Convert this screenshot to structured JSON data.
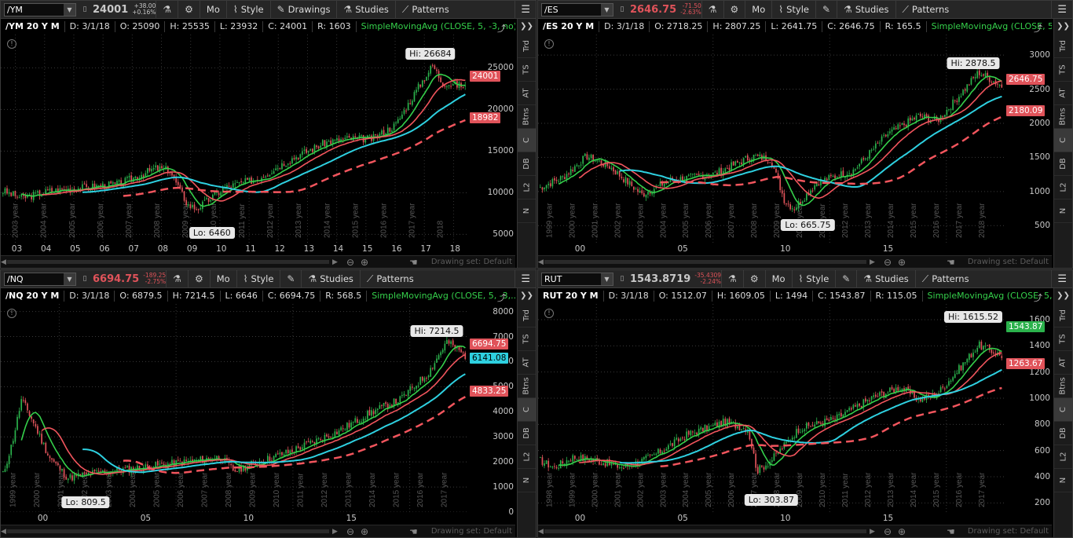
{
  "panels": [
    {
      "symbol": "/YM",
      "price": "24001",
      "price_color": "#c8c8c8",
      "chg1": "+38.00",
      "chg2": "+0.16%",
      "chg_color": "#c8c8c8",
      "buttons": [
        "Mo",
        "Style",
        "Drawings",
        "Studies",
        "Patterns"
      ],
      "info": [
        "/YM 20 Y M",
        "D: 3/1/18",
        "O: 25090",
        "H: 25535",
        "L: 23932",
        "C: 24001",
        "R: 1603",
        "SimpleMovingAvg (CLOSE, 5, -3, no)"
      ],
      "y_ticks": [
        "25000",
        "20000",
        "15000",
        "10000",
        "5000"
      ],
      "hi": "Hi: 26684",
      "lo": "Lo: 6460",
      "tags": [
        {
          "text": "24001",
          "color": "#e0535a"
        },
        {
          "text": "18982",
          "color": "#e0535a"
        }
      ],
      "x_ticks": [
        "03",
        "04",
        "05",
        "06",
        "07",
        "08",
        "09",
        "10",
        "11",
        "12",
        "13",
        "14",
        "15",
        "16",
        "17",
        "18"
      ],
      "year_labels": [
        "2003 year",
        "2004 year",
        "2005 year",
        "2006 year",
        "2007 year",
        "2008 year",
        "2009 year",
        "2010 year",
        "2011 year",
        "2012 year",
        "2013 year",
        "2014 year",
        "2015 year",
        "2016 year",
        "2017 year",
        "2018"
      ],
      "drawing_set": "Drawing set: Default"
    },
    {
      "symbol": "/ES",
      "price": "2646.75",
      "price_color": "#e0535a",
      "chg1": "-71.50",
      "chg2": "-2.63%",
      "chg_color": "#e0535a",
      "buttons": [
        "Mo",
        "Style",
        "",
        "Studies",
        "Patterns"
      ],
      "info": [
        "/ES 20 Y M",
        "D: 3/1/18",
        "O: 2718.25",
        "H: 2807.25",
        "L: 2641.75",
        "C: 2646.75",
        "R: 165.5",
        "SimpleMovingAvg (CLOSE, 5,..."
      ],
      "y_ticks": [
        "3000",
        "2500",
        "2000",
        "1500",
        "1000",
        "500"
      ],
      "hi": "Hi: 2878.5",
      "lo": "Lo: 665.75",
      "tags": [
        {
          "text": "2646.75",
          "color": "#e0535a"
        },
        {
          "text": "2180.09",
          "color": "#e0535a"
        }
      ],
      "x_ticks": [
        "00",
        "05",
        "10",
        "15"
      ],
      "year_labels": [
        "1999 year",
        "2000 year",
        "2001 year",
        "2002 year",
        "2003 year",
        "2004 year",
        "2005 year",
        "2006 year",
        "2007 year",
        "2008 year",
        "2009 year",
        "2010 year",
        "2011 year",
        "2012 year",
        "2013 year",
        "2014 year",
        "2015 year",
        "2016 year",
        "2017 year",
        "2018 year"
      ],
      "drawing_set": "Drawing set: Default"
    },
    {
      "symbol": "/NQ",
      "price": "6694.75",
      "price_color": "#e0535a",
      "chg1": "-189.25",
      "chg2": "-2.75%",
      "chg_color": "#e0535a",
      "buttons": [
        "Mo",
        "Style",
        "",
        "Studies",
        "Patterns"
      ],
      "info": [
        "/NQ 20 Y M",
        "D: 3/1/18",
        "O: 6879.5",
        "H: 7214.5",
        "L: 6646",
        "C: 6694.75",
        "R: 568.5",
        "SimpleMovingAvg (CLOSE, 5, -3,..."
      ],
      "y_ticks": [
        "8000",
        "7000",
        "6000",
        "5000",
        "4000",
        "3000",
        "2000",
        "1000",
        "0"
      ],
      "hi": "Hi: 7214.5",
      "lo": "Lo: 809.5",
      "tags": [
        {
          "text": "6694.75",
          "color": "#e0535a"
        },
        {
          "text": "6141.08",
          "color": "#2ed0e0"
        },
        {
          "text": "4833.25",
          "color": "#e0535a"
        }
      ],
      "x_ticks": [
        "00",
        "05",
        "10",
        "15"
      ],
      "year_labels": [
        "1999 year",
        "2000 year",
        "2001 year",
        "2002 year",
        "2003 year",
        "2004 year",
        "2005 year",
        "2006 year",
        "2007 year",
        "2008 year",
        "2009 year",
        "2010 year",
        "2011 year",
        "2012 year",
        "2013 year",
        "2014 year",
        "2015 year",
        "2016 year",
        "2017 year"
      ],
      "drawing_set": "Drawing set: Default"
    },
    {
      "symbol": "RUT",
      "price": "1543.8719",
      "price_color": "#c8c8c8",
      "chg1": "-35.4309",
      "chg2": "-2.24%",
      "chg_color": "#e0535a",
      "buttons": [
        "Mo",
        "Style",
        "",
        "Studies",
        "Patterns"
      ],
      "info": [
        "RUT 20 Y M",
        "D: 3/1/18",
        "O: 1512.07",
        "H: 1609.05",
        "L: 1494",
        "C: 1543.87",
        "R: 115.05",
        "SimpleMovingAvg (CLOSE, 5, -3,..."
      ],
      "y_ticks": [
        "1600",
        "1400",
        "1200",
        "1000",
        "800",
        "600",
        "400",
        "200"
      ],
      "hi": "Hi: 1615.52",
      "lo": "Lo: 303.87",
      "tags": [
        {
          "text": "1543.87",
          "color": "#2bb24c"
        },
        {
          "text": "1263.67",
          "color": "#e0535a"
        }
      ],
      "x_ticks": [
        "00",
        "05",
        "10",
        "15"
      ],
      "year_labels": [
        "1998 year",
        "1999 year",
        "2000 year",
        "2001 year",
        "2002 year",
        "2003 year",
        "2004 year",
        "2005 year",
        "2006 year",
        "2007 year",
        "2008 year",
        "2009 year",
        "2010 year",
        "2011 year",
        "2012 year",
        "2013 year",
        "2014 year",
        "2015 year",
        "2016 year",
        "2017 year"
      ],
      "drawing_set": "Drawing set: Default"
    }
  ],
  "side_buttons": [
    "Trd",
    "TS",
    "AT",
    "Btns",
    "C",
    "DB",
    "L2",
    "N"
  ],
  "colors": {
    "up": "#2bb24c",
    "down": "#e0535a",
    "sma_red": "#f2555d",
    "sma_cyan": "#2ed0e0",
    "sma_green": "#35d04b"
  }
}
